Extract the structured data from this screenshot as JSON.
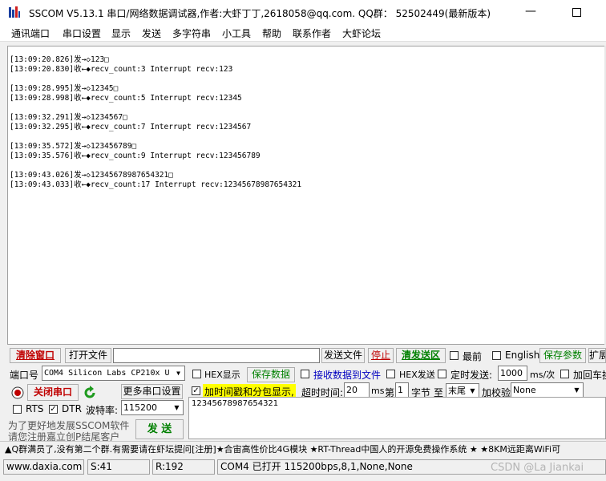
{
  "window": {
    "title": "SSCOM V5.13.1 串口/网络数据调试器,作者:大虾丁丁,2618058@qq.com. QQ群： 52502449(最新版本)",
    "min_glyph": "—"
  },
  "menu": [
    "通讯端口",
    "串口设置",
    "显示",
    "发送",
    "多字符串",
    "小工具",
    "帮助",
    "联系作者",
    "大虾论坛"
  ],
  "log": [
    "[13:09:20.826]发→◇123□",
    "[13:09:20.830]收←◆recv_count:3 Interrupt recv:123",
    "",
    "[13:09:28.995]发→◇12345□",
    "[13:09:28.998]收←◆recv_count:5 Interrupt recv:12345",
    "",
    "[13:09:32.291]发→◇1234567□",
    "[13:09:32.295]收←◆recv_count:7 Interrupt recv:1234567",
    "",
    "[13:09:35.572]发→◇123456789□",
    "[13:09:35.576]收←◆recv_count:9 Interrupt recv:123456789",
    "",
    "[13:09:43.026]发→◇12345678987654321□",
    "[13:09:43.033]收←◆recv_count:17 Interrupt recv:12345678987654321"
  ],
  "toolbar1": {
    "clear_window": "清除窗口",
    "open_file": "打开文件",
    "file_path": "",
    "send_file": "发送文件",
    "stop": "停止",
    "clear_send": "清发送区",
    "topmost": "最前",
    "english": "English",
    "save_params": "保存参数",
    "expand": "扩展"
  },
  "toolbar2": {
    "port_label": "端口号",
    "port_value": "COM4 Silicon Labs CP210x U",
    "hex_display": "HEX显示",
    "save_data": "保存数据",
    "recv_to_file": "接收数据到文件",
    "hex_send": "HEX发送",
    "timed_send": "定时发送:",
    "interval": "1000",
    "interval_unit": "ms/次",
    "add_crlf": "加回车换行"
  },
  "toolbar3": {
    "close_port": "关闭串口",
    "more_settings": "更多串口设置",
    "timestamp_split": "加时间戳和分包显示,",
    "timeout_label": "超时时间:",
    "timeout_value": "20",
    "timeout_unit": "ms",
    "nth_label": "第",
    "nth_value": "1",
    "byte_label": "字节",
    "to_label": "至",
    "end_value": "末尾",
    "checksum_label": "加校验",
    "checksum_value": "None"
  },
  "toolbar4": {
    "rts": "RTS",
    "dtr": "DTR",
    "baud_label": "波特率:",
    "baud_value": "115200"
  },
  "promo": {
    "line1": "为了更好地发展SSCOM软件",
    "line2": "请您注册嘉立创P结尾客户"
  },
  "send_button": "发 送",
  "send_text": "12345678987654321",
  "ticker": "▲Q群满员了,没有第二个群.有需要请在虾坛提问[注册]★合宙高性价比4G模块 ★RT-Thread中国人的开源免费操作系统 ★ ★8KM远距离WiFi可",
  "status": {
    "site": "www.daxia.com",
    "sent": "S:41",
    "received": "R:192",
    "port_info": "COM4 已打开  115200bps,8,1,None,None"
  },
  "watermark": "CSDN @La Jiankai",
  "colors": {
    "accent_red": "#c00000",
    "accent_green": "#008000",
    "accent_blue": "#0000c0",
    "highlight": "#ffff00"
  }
}
